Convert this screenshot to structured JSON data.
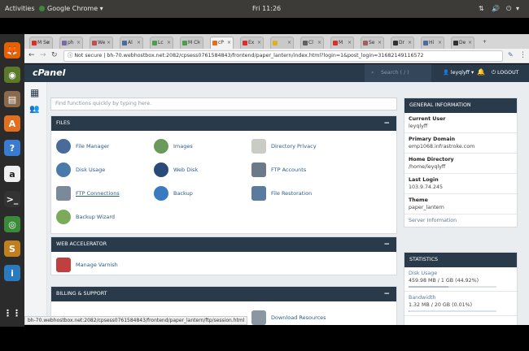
{
  "system": {
    "activities": "Activities",
    "app_menu": "Google Chrome",
    "clock": "Fri 11:26"
  },
  "launcher": [
    {
      "name": "firefox-icon",
      "glyph": "🦊",
      "color": "#e66000"
    },
    {
      "name": "rhythmbox-icon",
      "glyph": "◉",
      "color": "#5a7a2a"
    },
    {
      "name": "files-icon",
      "glyph": "▤",
      "color": "#8a6a4a"
    },
    {
      "name": "software-center-icon",
      "glyph": "A",
      "color": "#e07020"
    },
    {
      "name": "help-icon",
      "glyph": "?",
      "color": "#3a7ad0"
    },
    {
      "name": "amazon-icon",
      "glyph": "a",
      "color": "#f0f0f0"
    },
    {
      "name": "terminal-icon",
      "glyph": ">_",
      "color": "#333333"
    },
    {
      "name": "chrome-icon",
      "glyph": "◎",
      "color": "#3a8a3a"
    },
    {
      "name": "sublime-icon",
      "glyph": "S",
      "color": "#c08020"
    },
    {
      "name": "libreoffice-icon",
      "glyph": "i",
      "color": "#2a7ac0"
    },
    {
      "name": "apps-grid-icon",
      "glyph": "⋮⋮",
      "color": "#2b2b2b"
    }
  ],
  "tabs": [
    {
      "label": "M Se",
      "color": "#d93025"
    },
    {
      "label": "ph",
      "color": "#7a6aa0"
    },
    {
      "label": "We",
      "color": "#c05050"
    },
    {
      "label": "Al",
      "color": "#4a6aa0"
    },
    {
      "label": "Lc",
      "color": "#4aa04a"
    },
    {
      "label": "M Cl",
      "color": "#4aa04a"
    },
    {
      "label": "cP",
      "color": "#e07020",
      "active": true
    },
    {
      "label": "Ex",
      "color": "#d93025"
    },
    {
      "label": "",
      "color": "#e0b020"
    },
    {
      "label": "Cl",
      "color": "#606060"
    },
    {
      "label": "M",
      "color": "#d93025"
    },
    {
      "label": "Se",
      "color": "#a06060"
    },
    {
      "label": "Dr",
      "color": "#303030"
    },
    {
      "label": "Hi",
      "color": "#4a6aa0"
    },
    {
      "label": "De",
      "color": "#303030"
    }
  ],
  "address": {
    "security": "Not secure",
    "url": "bh-70.webhostbox.net:2082/cpsess0761584843/frontend/paper_lantern/index.html?login=1&post_login=31682149116572"
  },
  "cpanel": {
    "logo": "cPanel",
    "search_placeholder": "Search ( / )",
    "username": "leyqlyff",
    "logout": "LOGOUT",
    "find_placeholder": "Find functions quickly by typing here."
  },
  "files": {
    "title": "FILES",
    "items": [
      {
        "label": "File Manager",
        "name": "file-manager-link",
        "icon": "file-manager-icon",
        "color": "#4a6a9a"
      },
      {
        "label": "Images",
        "name": "images-link",
        "icon": "images-icon",
        "color": "#6a9a5a"
      },
      {
        "label": "Directory Privacy",
        "name": "directory-privacy-link",
        "icon": "folder-icon",
        "color": "#c9ccc4"
      },
      {
        "label": "Disk Usage",
        "name": "disk-usage-link",
        "icon": "disk-usage-icon",
        "color": "#4a7aaa"
      },
      {
        "label": "Web Disk",
        "name": "web-disk-link",
        "icon": "web-disk-icon",
        "color": "#2a4a7a"
      },
      {
        "label": "FTP Accounts",
        "name": "ftp-accounts-link",
        "icon": "ftp-accounts-icon",
        "color": "#6a7a8a"
      },
      {
        "label": "FTP Connections",
        "name": "ftp-connections-link",
        "icon": "ftp-connections-icon",
        "color": "#7a8a9a"
      },
      {
        "label": "Backup",
        "name": "backup-link",
        "icon": "backup-icon",
        "color": "#3a7ac0"
      },
      {
        "label": "File Restoration",
        "name": "file-restoration-link",
        "icon": "file-restoration-icon",
        "color": "#5a7aa0"
      },
      {
        "label": "Backup Wizard",
        "name": "backup-wizard-link",
        "icon": "backup-wizard-icon",
        "color": "#7aaa5a"
      }
    ]
  },
  "web_accelerator": {
    "title": "WEB ACCELERATOR",
    "items": [
      {
        "label": "Manage Varnish",
        "name": "manage-varnish-link",
        "icon": "varnish-icon",
        "color": "#c04040"
      }
    ]
  },
  "billing": {
    "title": "BILLING & SUPPORT",
    "items": [
      {
        "label": "Download Resources",
        "name": "download-resources-link",
        "icon": "download-resources-icon",
        "color": "#8a96a2"
      }
    ]
  },
  "general_info": {
    "title": "GENERAL INFORMATION",
    "current_user_label": "Current User",
    "current_user": "leyqlyff",
    "primary_domain_label": "Primary Domain",
    "primary_domain": "emp1068.infrastroke.com",
    "home_dir_label": "Home Directory",
    "home_dir": "/home/leyqlyff",
    "last_login_label": "Last Login",
    "last_login": "103.9.74.245",
    "theme_label": "Theme",
    "theme": "paper_lantern",
    "server_info": "Server Information"
  },
  "statistics": {
    "title": "STATISTICS",
    "disk_label": "Disk Usage",
    "disk_value": "459.98 MB / 1 GB   (44.92%)",
    "disk_fraction": 0.4492,
    "bandwidth_label": "Bandwidth",
    "bandwidth_value": "1.32 MB / 20 GB   (0.01%)",
    "bandwidth_fraction": 0.0001
  },
  "status_url": "bh-70.webhostbox.net:2082/cpsess0761584843/frontend/paper_lantern/ftp/session.html"
}
